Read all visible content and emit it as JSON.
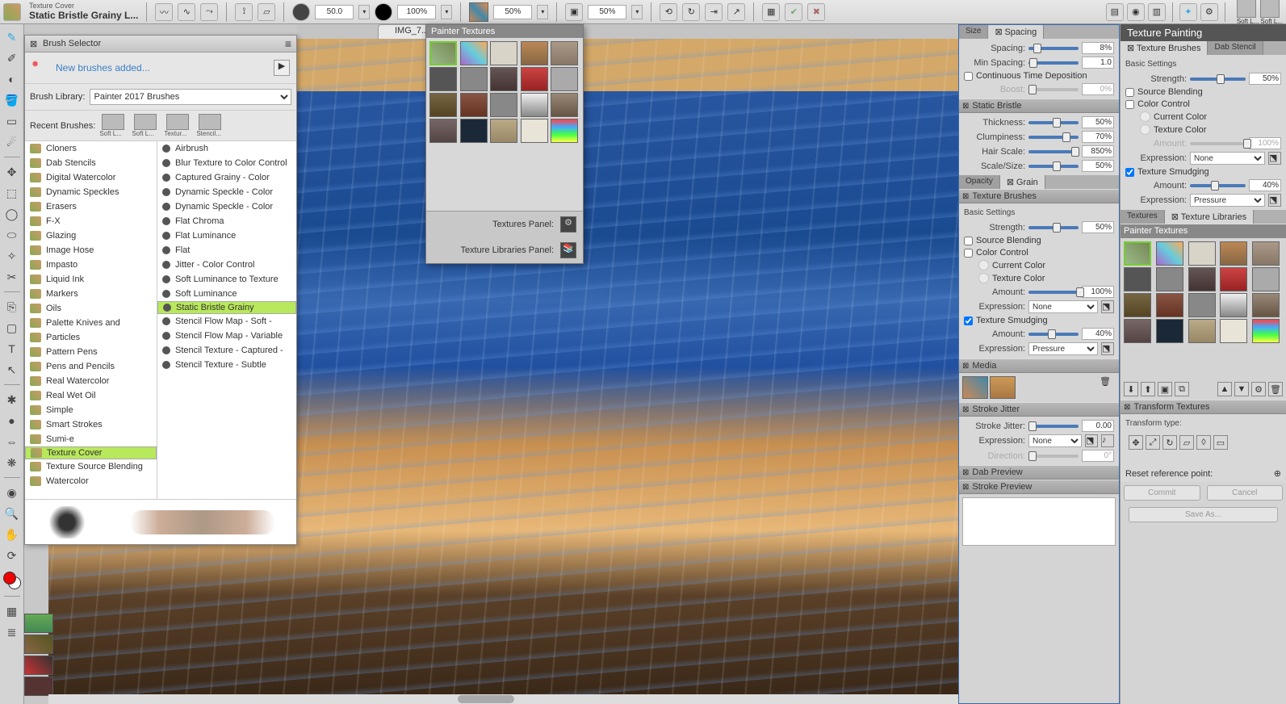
{
  "topbar": {
    "brush_category": "Texture Cover",
    "brush_name": "Static Bristle Grainy L...",
    "size": "50.0",
    "opacity": "100%",
    "grain": "50%",
    "resat": "50%",
    "recent_labels": [
      "Soft L...",
      "Soft L..."
    ]
  },
  "doc_tab": "IMG_7...",
  "brush_selector": {
    "title": "Brush Selector",
    "new_brushes": "New brushes added...",
    "library_label": "Brush Library:",
    "library_value": "Painter 2017 Brushes",
    "recent_label": "Recent Brushes:",
    "recent": [
      "Soft L...",
      "Soft L...",
      "Textur...",
      "Stencil..."
    ],
    "categories": [
      "Cloners",
      "Dab Stencils",
      "Digital Watercolor",
      "Dynamic Speckles",
      "Erasers",
      "F-X",
      "Glazing",
      "Image Hose",
      "Impasto",
      "Liquid Ink",
      "Markers",
      "Oils",
      "Palette Knives and",
      "Particles",
      "Pattern Pens",
      "Pens and Pencils",
      "Real Watercolor",
      "Real Wet Oil",
      "Simple",
      "Smart Strokes",
      "Sumi-e",
      "Texture Cover",
      "Texture Source Blending",
      "Watercolor"
    ],
    "category_selected": "Texture Cover",
    "variants": [
      "Airbrush",
      "Blur Texture to Color Control",
      "Captured Grainy - Color",
      "Dynamic Speckle - Color",
      "Dynamic Speckle - Color",
      "Flat Chroma",
      "Flat Luminance",
      "Flat",
      "Jitter - Color Control",
      "Soft Luminance to Texture",
      "Soft Luminance",
      "Static Bristle Grainy",
      "Stencil Flow Map - Soft -",
      "Stencil Flow Map - Variable",
      "Stencil Texture - Captured -",
      "Stencil Texture - Subtle"
    ],
    "variant_selected": "Static Bristle Grainy"
  },
  "tex_popover": {
    "title": "Painter Textures",
    "textures_panel": "Textures Panel:",
    "libraries_panel": "Texture Libraries Panel:"
  },
  "panels": {
    "size": "Size",
    "spacing_tab": "Spacing",
    "spacing": {
      "spacing_lbl": "Spacing:",
      "spacing_val": "8%",
      "minspacing_lbl": "Min Spacing:",
      "minspacing_val": "1.0",
      "ctd": "Continuous Time Deposition",
      "boost_lbl": "Boost:",
      "boost_val": "0%"
    },
    "static_bristle": {
      "title": "Static Bristle",
      "thickness_lbl": "Thickness:",
      "thickness_val": "50%",
      "clumpiness_lbl": "Clumpiness:",
      "clumpiness_val": "70%",
      "hairscale_lbl": "Hair Scale:",
      "hairscale_val": "850%",
      "scalesize_lbl": "Scale/Size:",
      "scalesize_val": "50%"
    },
    "opacity": "Opacity",
    "grain_tab": "Grain",
    "texture_brushes": {
      "title": "Texture Brushes",
      "basic": "Basic Settings",
      "strength_lbl": "Strength:",
      "strength_val": "50%",
      "source_blending": "Source Blending",
      "color_control": "Color Control",
      "current_color": "Current Color",
      "texture_color": "Texture Color",
      "amount_lbl": "Amount:",
      "amount_val": "100%",
      "expression_lbl": "Expression:",
      "expression_val": "None",
      "smudging": "Texture Smudging",
      "sm_amount_val": "40%",
      "sm_expression_val": "Pressure"
    },
    "media": "Media",
    "stroke_jitter": {
      "title": "Stroke Jitter",
      "sj_lbl": "Stroke Jitter:",
      "sj_val": "0.00",
      "expr_lbl": "Expression:",
      "expr_val": "None",
      "dir_lbl": "Direction:",
      "dir_val": "0°"
    },
    "dab_preview": "Dab Preview",
    "stroke_preview": "Stroke Preview"
  },
  "right2": {
    "title": "Texture Painting",
    "tab_brushes": "Texture Brushes",
    "tab_stencil": "Dab Stencil",
    "basic": "Basic Settings",
    "strength_lbl": "Strength:",
    "strength_val": "50%",
    "source_blending": "Source Blending",
    "color_control": "Color Control",
    "current_color": "Current Color",
    "texture_color": "Texture Color",
    "amount_lbl": "Amount:",
    "amount_val": "100%",
    "expression_lbl": "Expression:",
    "expression_val": "None",
    "smudging": "Texture Smudging",
    "sm_amount_val": "40%",
    "sm_expr_val": "Pressure",
    "textures_tab": "Textures",
    "texlib_tab": "Texture Libraries",
    "painter_textures": "Painter Textures",
    "transform": "Transform Textures",
    "transform_type": "Transform type:",
    "reset_ref": "Reset reference point:",
    "commit": "Commit",
    "cancel": "Cancel",
    "save_as": "Save As..."
  }
}
